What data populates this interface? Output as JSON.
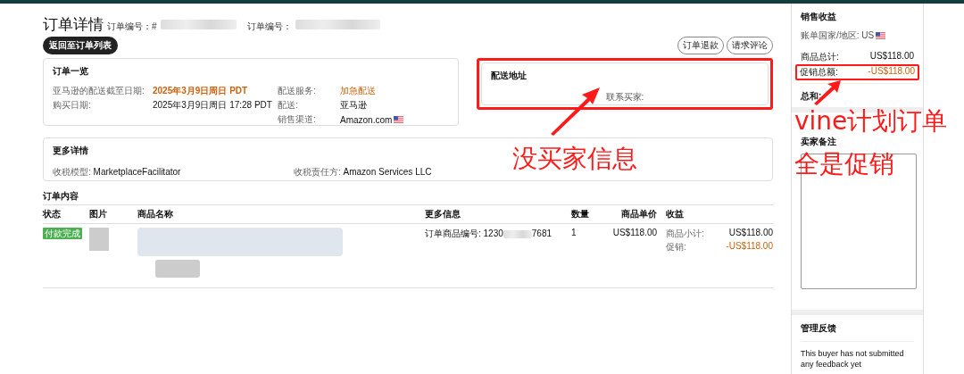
{
  "header": {
    "title": "订单详情",
    "order_label_1": "订单编号：#",
    "order_label_2": "订单编号：",
    "back_button": "返回至订单列表",
    "actions": [
      "订单退款",
      "请求评论"
    ]
  },
  "order_summary": {
    "title": "订单一览",
    "left": [
      {
        "label": "亚马逊的配送截至日期:",
        "value": "2025年3月9日周日 PDT",
        "highlight": true
      },
      {
        "label": "购买日期:",
        "value": "2025年3月9日周日 17:28 PDT",
        "highlight": false
      }
    ],
    "right": [
      {
        "label": "配送服务:",
        "value": "加急配送",
        "highlight": true,
        "flag": false
      },
      {
        "label": "配送:",
        "value": "亚马逊",
        "highlight": false,
        "flag": false
      },
      {
        "label": "销售渠道:",
        "value": "Amazon.com",
        "highlight": false,
        "flag": true
      }
    ]
  },
  "shipping": {
    "title": "配送地址",
    "contact_label": "联系买家:"
  },
  "more_details": {
    "title": "更多详情",
    "items": [
      {
        "label": "收税模型:",
        "value": "MarketplaceFacilitator"
      },
      {
        "label": "收税责任方:",
        "value": "Amazon Services LLC"
      }
    ]
  },
  "order_contents": {
    "title": "订单内容",
    "columns": [
      "状态",
      "图片",
      "商品名称",
      "更多信息",
      "数量",
      "商品单价",
      "收益"
    ],
    "rows": [
      {
        "status": "付款完成",
        "item_id_label": "订单商品编号:",
        "item_id_start": "1230",
        "item_id_end": "7681",
        "quantity": "1",
        "unit_price": "US$118.00",
        "proceeds": [
          {
            "label": "商品小计:",
            "value": "US$118.00",
            "negative": false
          },
          {
            "label": "促销:",
            "value": "-US$118.00",
            "negative": true
          }
        ]
      }
    ]
  },
  "sidebar": {
    "title": "销售收益",
    "country": "账单国家/地区: US",
    "lines": [
      {
        "label": "商品总计:",
        "value": "US$118.00",
        "negative": false
      },
      {
        "label": "促销总额:",
        "value": "-US$118.00",
        "negative": true
      }
    ],
    "total_label": "总和:",
    "notes_title": "卖家备注",
    "feedback_title": "管理反馈",
    "feedback_text": "This buyer has not submitted any feedback yet"
  },
  "annotations": [
    "没买家信息",
    "vine计划订单",
    "全是促销"
  ]
}
